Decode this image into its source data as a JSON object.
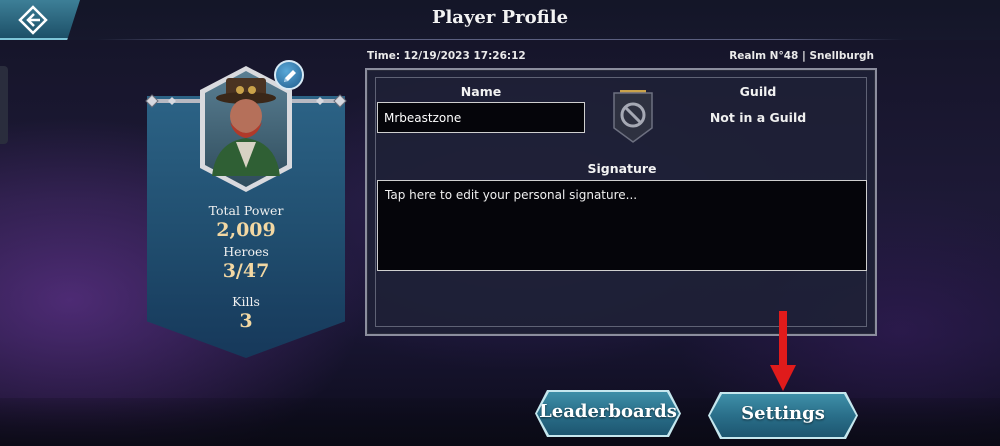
{
  "header": {
    "title": "Player Profile",
    "back_icon": "back-arrow-icon"
  },
  "profile": {
    "stats": [
      {
        "label": "Total Power",
        "value": "2,009"
      },
      {
        "label": "Heroes",
        "value": "3/47"
      },
      {
        "label": "Kills",
        "value": "3"
      }
    ],
    "edit_icon": "pencil-icon"
  },
  "info": {
    "time": "Time: 12/19/2023 17:26:12",
    "realm": "Realm N°48 | Snellburgh",
    "name_label": "Name",
    "name_value": "Mrbeastzone",
    "guild_label": "Guild",
    "guild_status": "Not in a Guild",
    "signature_label": "Signature",
    "signature_placeholder": "Tap here to edit your personal signature..."
  },
  "buttons": {
    "leaderboards": "Leaderboards",
    "settings": "Settings"
  },
  "colors": {
    "accent_blue": "#2a6f8a",
    "banner_blue": "#204d6e",
    "value_gold": "#f3d8a3",
    "annotation_red": "#e01b1b"
  }
}
